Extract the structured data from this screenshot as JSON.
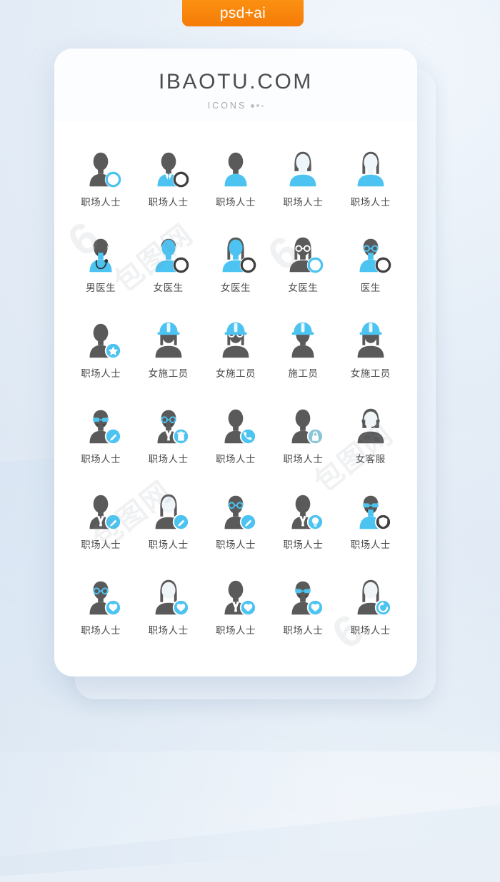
{
  "badge": {
    "label": "psd+ai"
  },
  "header": {
    "brand": "IBAOTU.COM",
    "subtitle": "ICONS"
  },
  "colors": {
    "accent_blue": "#4cc3f0",
    "figure_gray": "#5a5a5a",
    "label_gray": "#4a4a4a",
    "badge_orange": "#f57c08",
    "card_white": "#ffffff",
    "background_blue": "#e1eaf5"
  },
  "watermarks": [
    "6",
    "包图网",
    "6",
    "包图网",
    "包图网",
    "6"
  ],
  "icons": [
    {
      "label": "职场人士",
      "icon": "person-male-circle-badge-icon",
      "row": 1,
      "col": 1
    },
    {
      "label": "职场人士",
      "icon": "person-suit-circle-badge-icon",
      "row": 1,
      "col": 2
    },
    {
      "label": "职场人士",
      "icon": "person-male-plain-icon",
      "row": 1,
      "col": 3
    },
    {
      "label": "职场人士",
      "icon": "person-female-plain-icon",
      "row": 1,
      "col": 4
    },
    {
      "label": "职场人士",
      "icon": "person-female-longhair-icon",
      "row": 1,
      "col": 5
    },
    {
      "label": "男医生",
      "icon": "doctor-male-stethoscope-icon",
      "row": 2,
      "col": 1
    },
    {
      "label": "女医生",
      "icon": "doctor-female-circle-badge-icon",
      "row": 2,
      "col": 2
    },
    {
      "label": "女医生",
      "icon": "doctor-female-longhair-badge-icon",
      "row": 2,
      "col": 3
    },
    {
      "label": "女医生",
      "icon": "doctor-female-glasses-badge-icon",
      "row": 2,
      "col": 4
    },
    {
      "label": "医生",
      "icon": "doctor-glasses-circle-badge-icon",
      "row": 2,
      "col": 5
    },
    {
      "label": "职场人士",
      "icon": "person-star-badge-icon",
      "row": 3,
      "col": 1
    },
    {
      "label": "女施工员",
      "icon": "worker-female-helmet-icon",
      "row": 3,
      "col": 2
    },
    {
      "label": "女施工员",
      "icon": "worker-female-helmet-glasses-icon",
      "row": 3,
      "col": 3
    },
    {
      "label": "施工员",
      "icon": "worker-male-helmet-icon",
      "row": 3,
      "col": 4
    },
    {
      "label": "女施工员",
      "icon": "worker-female-helmet-long-icon",
      "row": 3,
      "col": 5
    },
    {
      "label": "职场人士",
      "icon": "person-sunglasses-pencil-badge-icon",
      "row": 4,
      "col": 1
    },
    {
      "label": "职场人士",
      "icon": "person-glasses-trash-badge-icon",
      "row": 4,
      "col": 2
    },
    {
      "label": "职场人士",
      "icon": "person-phone-badge-icon",
      "row": 4,
      "col": 3
    },
    {
      "label": "职场人士",
      "icon": "person-lock-badge-icon",
      "row": 4,
      "col": 4
    },
    {
      "label": "女客服",
      "icon": "support-agent-headset-icon",
      "row": 4,
      "col": 5
    },
    {
      "label": "职场人士",
      "icon": "person-suit-pencil-badge-icon",
      "row": 5,
      "col": 1
    },
    {
      "label": "职场人士",
      "icon": "person-female-pencil-badge-icon",
      "row": 5,
      "col": 2
    },
    {
      "label": "职场人士",
      "icon": "person-glasses-pencil-badge-icon",
      "row": 5,
      "col": 3
    },
    {
      "label": "职场人士",
      "icon": "person-suit-bulb-badge-icon",
      "row": 5,
      "col": 4
    },
    {
      "label": "职场人士",
      "icon": "person-mustache-shield-badge-icon",
      "row": 5,
      "col": 5
    },
    {
      "label": "职场人士",
      "icon": "person-glasses-heart-badge-icon",
      "row": 6,
      "col": 1
    },
    {
      "label": "职场人士",
      "icon": "person-female-heart-badge-icon",
      "row": 6,
      "col": 2
    },
    {
      "label": "职场人士",
      "icon": "person-suit-heart-badge-icon",
      "row": 6,
      "col": 3
    },
    {
      "label": "职场人士",
      "icon": "person-sunglasses-heart-badge-icon",
      "row": 6,
      "col": 4
    },
    {
      "label": "职场人士",
      "icon": "person-female-refresh-badge-icon",
      "row": 6,
      "col": 5
    }
  ]
}
